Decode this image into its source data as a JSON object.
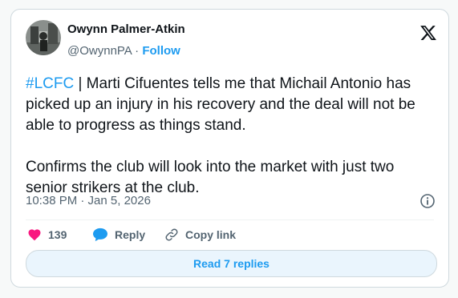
{
  "author": {
    "name": "Owynn Palmer-Atkin",
    "handle": "@OwynnPA",
    "separator": "·",
    "follow_label": "Follow"
  },
  "tweet": {
    "hashtag": "#LCFC",
    "text": " | Marti Cifuentes tells me that Michail Antonio has picked up an injury in his recovery and the deal will not be able to progress as things stand.\n\nConfirms the club will look into the market with just two senior strikers at the club.",
    "timestamp": "10:38 PM · Jan 5, 2026"
  },
  "actions": {
    "like_count": "139",
    "reply_label": "Reply",
    "copy_link_label": "Copy link"
  },
  "read_replies_label": "Read 7 replies",
  "colors": {
    "accent": "#1d9bf0",
    "like": "#f91880",
    "muted": "#536471",
    "reply_button_bg": "#eaf5fd"
  },
  "icons": [
    "x-logo-icon",
    "info-icon",
    "heart-icon",
    "reply-bubble-icon",
    "link-icon"
  ]
}
